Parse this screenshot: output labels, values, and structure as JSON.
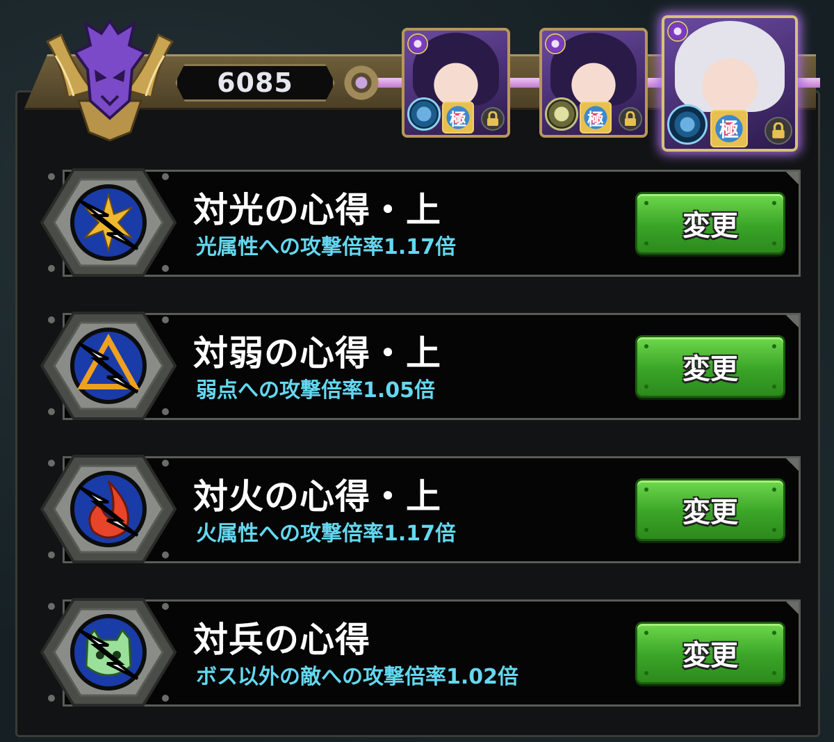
{
  "header": {
    "score": "6085"
  },
  "party": [
    {
      "name": "portrait-1",
      "elem_icon": "dark-element-icon",
      "kiwami": "極",
      "locked": true
    },
    {
      "name": "portrait-2",
      "elem_icon": "dark-element-icon",
      "kiwami": "極",
      "locked": true
    },
    {
      "name": "portrait-3",
      "elem_icon": "dark-element-icon",
      "kiwami": "極",
      "locked": true,
      "selected": true
    }
  ],
  "skills": [
    {
      "icon": "anti-light-icon",
      "title": "対光の心得・上",
      "desc": "光属性への攻撃倍率1.17倍",
      "button": "変更"
    },
    {
      "icon": "anti-weak-icon",
      "title": "対弱の心得・上",
      "desc": "弱点への攻撃倍率1.05倍",
      "button": "変更"
    },
    {
      "icon": "anti-fire-icon",
      "title": "対火の心得・上",
      "desc": "火属性への攻撃倍率1.17倍",
      "button": "変更"
    },
    {
      "icon": "anti-minion-icon",
      "title": "対兵の心得",
      "desc": "ボス以外の敵への攻撃倍率1.02倍",
      "button": "変更"
    }
  ],
  "colors": {
    "desc_text": "#64d8f0",
    "button_green": "#3aa428",
    "gold_trim": "#b89854",
    "emblem_purple": "#7a4ac8"
  }
}
